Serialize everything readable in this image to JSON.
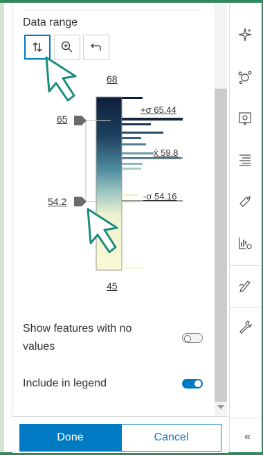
{
  "data_range": {
    "title": "Data range",
    "tools": [
      {
        "name": "flip-range",
        "icon": "up-down-arrows-icon",
        "active": true
      },
      {
        "name": "zoom",
        "icon": "zoom-in-icon",
        "active": false
      },
      {
        "name": "reset",
        "icon": "undo-icon",
        "active": false
      }
    ],
    "max_label": "68",
    "min_label": "45",
    "handle_high": "65",
    "handle_low": "54.2",
    "stats": {
      "plus_sigma": "+σ 65.44",
      "mean": "x̄ 59.8",
      "minus_sigma": "-σ 54.16"
    },
    "ramp_colors": [
      "#0e1f3a",
      "#1c3f5e",
      "#4f8ca0",
      "#9fc7c2",
      "#f3f5d6",
      "#fbf9d4"
    ]
  },
  "options": {
    "show_no_values": {
      "label_line1": "Show features with no",
      "label_line2": "values",
      "enabled": false
    },
    "include_legend": {
      "label": "Include in legend",
      "enabled": true
    }
  },
  "footer": {
    "done": "Done",
    "cancel": "Cancel"
  },
  "rail": {
    "icons": [
      "sparkle-icon",
      "clustering-icon",
      "configure-popup-icon",
      "fields-list-icon",
      "labels-tag-icon",
      "charts-gear-icon",
      "sketch-pen-icon",
      "wrench-icon"
    ],
    "collapse": "«"
  },
  "accent": "#007ac2",
  "cursor_color": "#1b8c7e"
}
